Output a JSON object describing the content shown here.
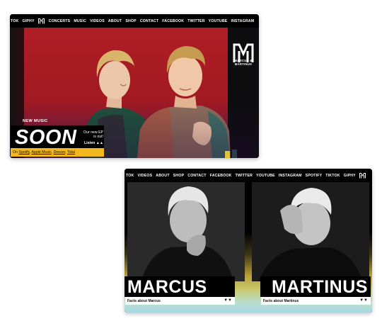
{
  "shot1": {
    "nav": [
      "TOK",
      "GIPHY",
      "CONCERTS",
      "MUSIC",
      "VIDEOS",
      "ABOUT",
      "SHOP",
      "CONTACT",
      "FACEBOOK",
      "TWITTER",
      "YOUTUBE",
      "INSTAGRAM"
    ],
    "logo_text_line1": "MARCUS &",
    "logo_text_line2": "MARTINUS",
    "new_music": "NEW MUSIC",
    "headline": "SOON",
    "ep_line1": "Our new EP",
    "ep_line2": "is out!",
    "listen": "Listen ▲▲",
    "stream_prefix": "On ",
    "stream_links": [
      "Spotify",
      "Apple Music",
      "Deezer",
      "Tidal"
    ],
    "colors": {
      "hero_red": "#b01d24",
      "accent_yellow": "#f3b71f"
    }
  },
  "shot2": {
    "nav": [
      "TOK",
      "VIDEOS",
      "ABOUT",
      "SHOP",
      "CONTACT",
      "FACEBOOK",
      "TWITTER",
      "YOUTUBE",
      "INSTAGRAM",
      "SPOTIFY",
      "TIKTOK",
      "GIPHY"
    ],
    "cards": [
      {
        "name": "MARCUS",
        "facts": "Facts about Marcus",
        "arrows": "▼▼"
      },
      {
        "name": "MARTINUS",
        "facts": "Facts about Martinus",
        "arrows": "▼▼"
      }
    ]
  }
}
